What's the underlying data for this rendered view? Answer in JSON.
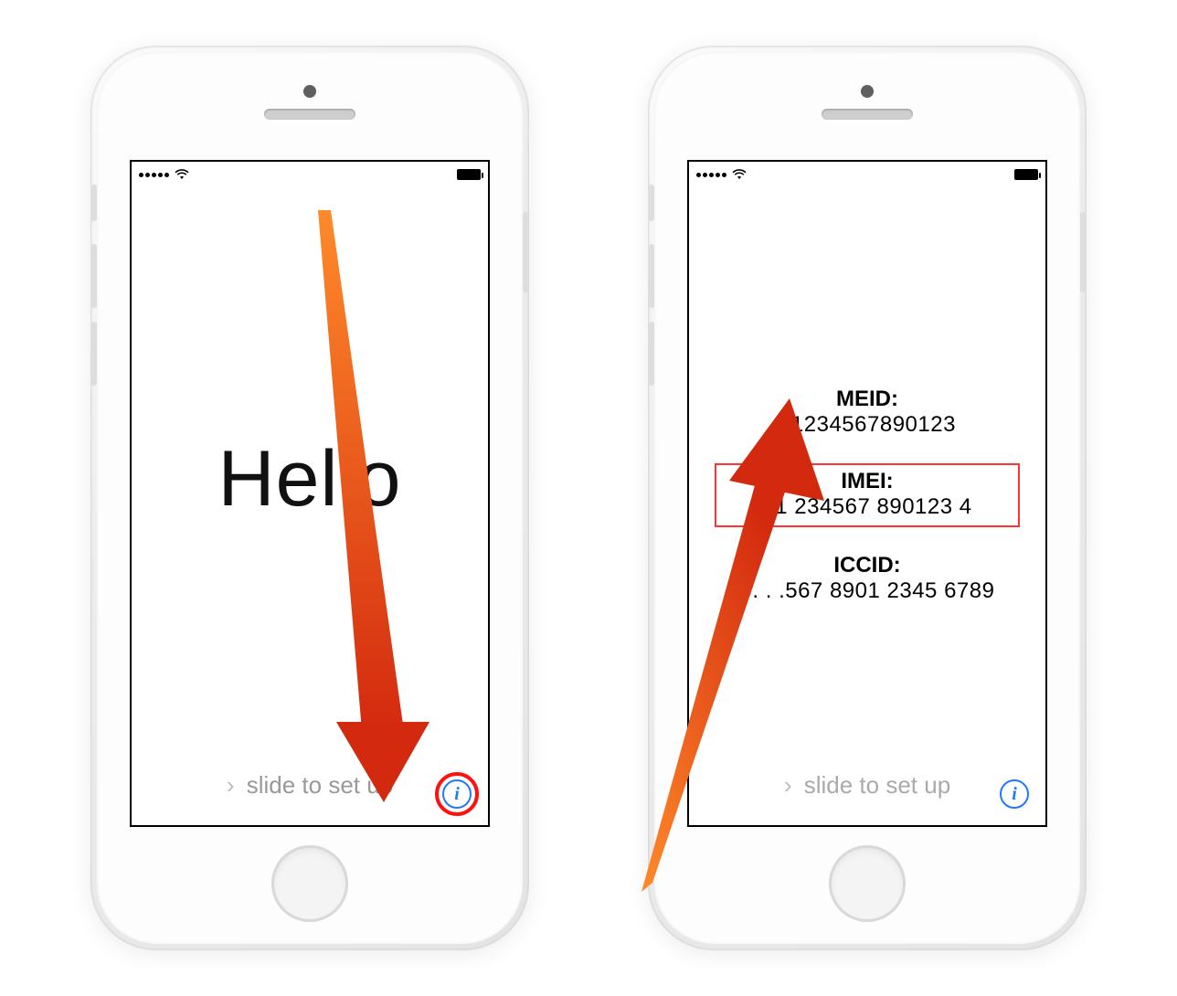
{
  "left_screen": {
    "greeting": "Hello",
    "slide_text": "slide to set up"
  },
  "right_screen": {
    "info": {
      "meid_label": "MEID:",
      "meid_value": "01234567890123",
      "imei_label": "IMEI:",
      "imei_value": "01 234567 890123 4",
      "iccid_label": "ICCID:",
      "iccid_value": "0. . .567 8901 2345 6789"
    },
    "slide_text": "slide to set up"
  },
  "colors": {
    "info_blue": "#1f78ff",
    "highlight_red": "#ff1111",
    "arrow_start": "#ff7a1a",
    "arrow_end": "#d32a0f"
  }
}
